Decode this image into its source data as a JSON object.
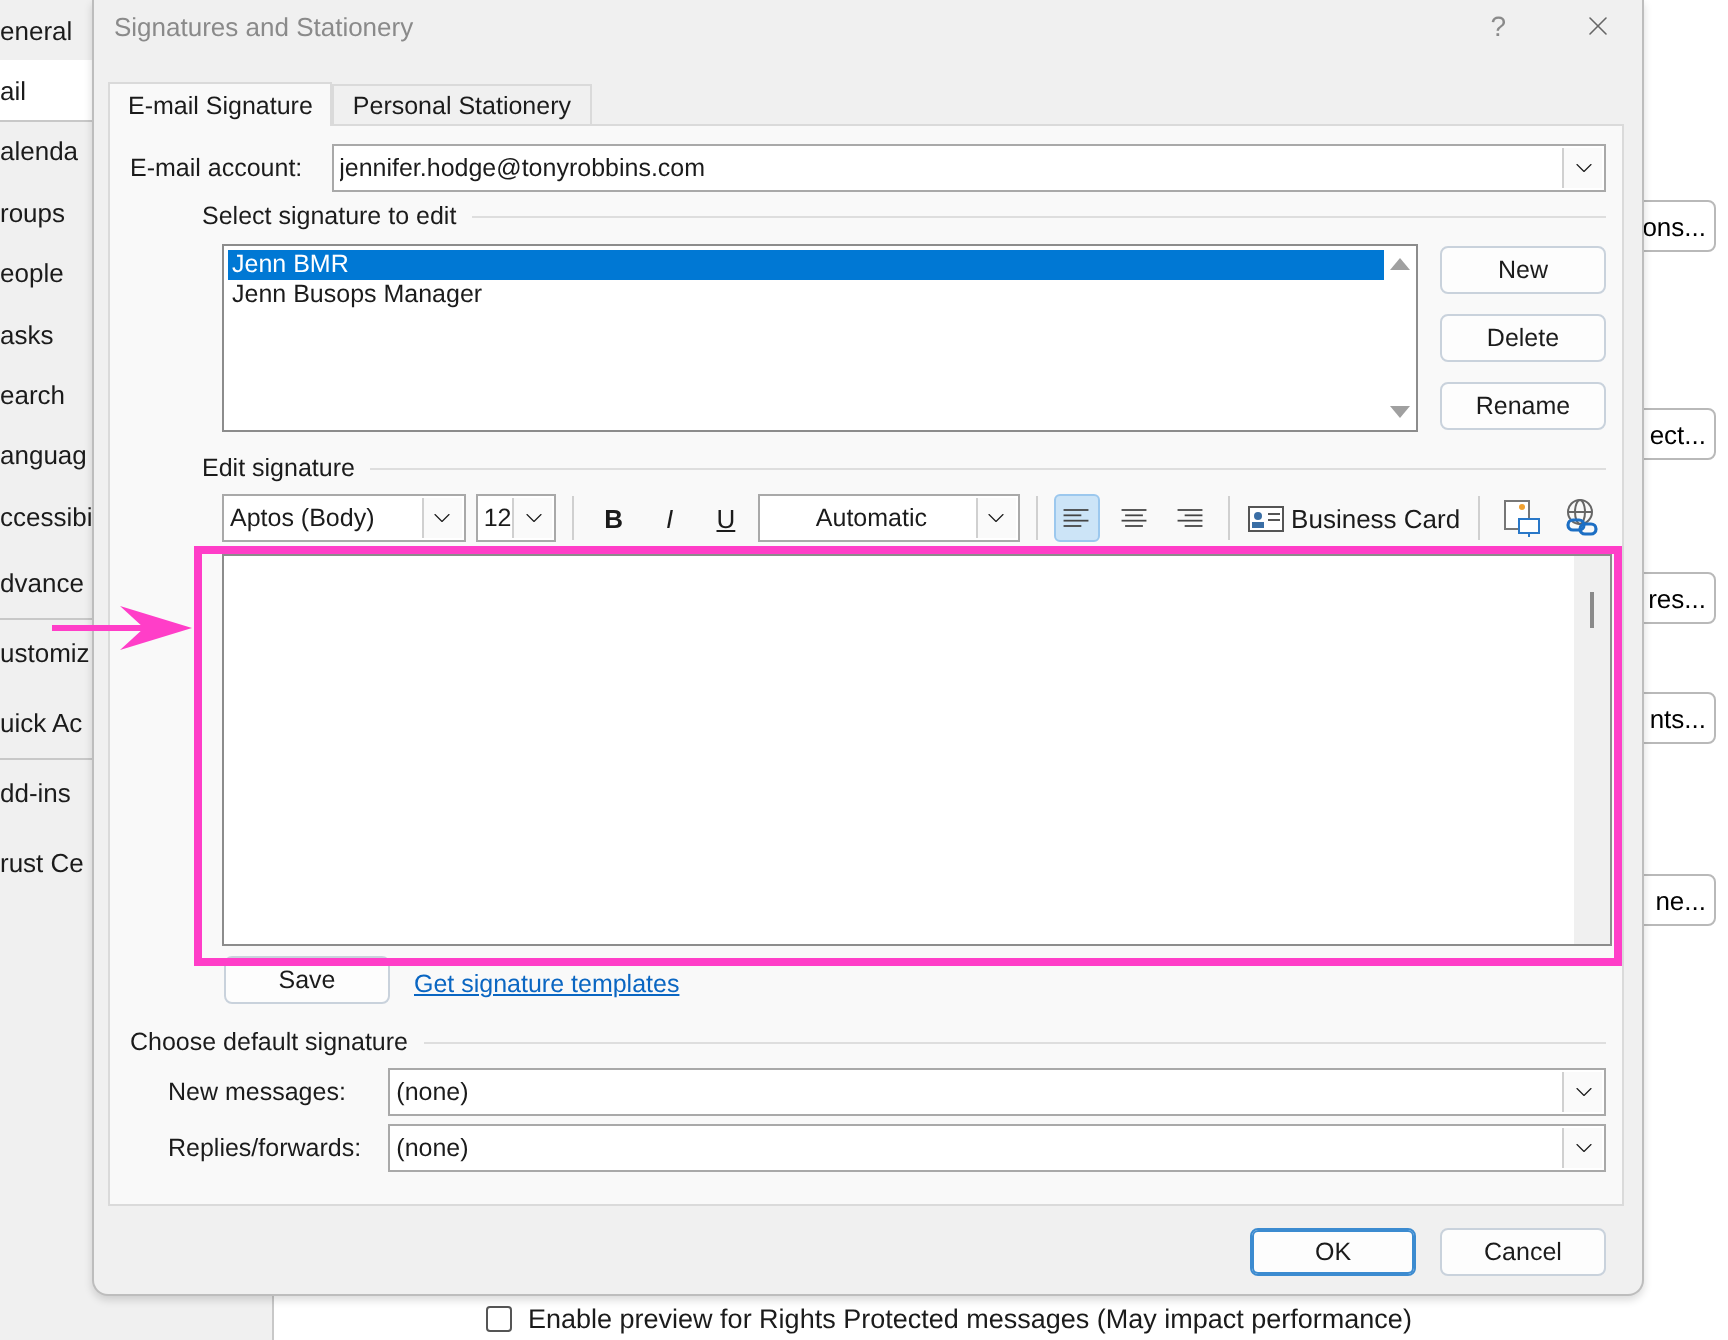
{
  "options_window": {
    "sidebar": [
      {
        "label": "eneral",
        "selected": false,
        "separator_before": false
      },
      {
        "label": "ail",
        "selected": true,
        "separator_before": false
      },
      {
        "label": "alenda",
        "selected": false,
        "separator_before": false
      },
      {
        "label": "roups",
        "selected": false,
        "separator_before": false
      },
      {
        "label": "eople",
        "selected": false,
        "separator_before": false
      },
      {
        "label": "asks",
        "selected": false,
        "separator_before": false
      },
      {
        "label": "earch",
        "selected": false,
        "separator_before": false
      },
      {
        "label": "anguag",
        "selected": false,
        "separator_before": false
      },
      {
        "label": "ccessibi",
        "selected": false,
        "separator_before": false
      },
      {
        "label": "dvance",
        "selected": false,
        "separator_before": false
      },
      {
        "label": "ustomiz",
        "selected": false,
        "separator_before": true
      },
      {
        "label": "uick Ac",
        "selected": false,
        "separator_before": false
      },
      {
        "label": "dd-ins",
        "selected": false,
        "separator_before": true
      },
      {
        "label": "rust Ce",
        "selected": false,
        "separator_before": false
      }
    ],
    "side_buttons": [
      "ons...",
      "ect...",
      "res...",
      "nts...",
      "ne..."
    ],
    "option": {
      "label": "Enable preview for Rights Protected messages (May impact performance)",
      "checked": false
    }
  },
  "dialog": {
    "title": "Signatures and Stationery",
    "help": "?",
    "tabs": [
      {
        "label": "E-mail Signature",
        "selected": true
      },
      {
        "label": "Personal Stationery",
        "selected": false
      }
    ],
    "account": {
      "label": "E-mail account:",
      "value": "jennifer.hodge@tonyrobbins.com"
    },
    "select_label": "Select signature to edit",
    "signatures": [
      {
        "name": "Jenn BMR",
        "selected": true
      },
      {
        "name": "Jenn Busops Manager",
        "selected": false
      }
    ],
    "signature_buttons": [
      "New",
      "Delete",
      "Rename"
    ],
    "edit_label": "Edit signature",
    "toolbar": {
      "font": "Aptos (Body)",
      "size": "12",
      "bold": "B",
      "italic": "I",
      "underline": "U",
      "font_color_label": "Automatic",
      "align": [
        {
          "kind": "left",
          "selected": true
        },
        {
          "kind": "center",
          "selected": false
        },
        {
          "kind": "right",
          "selected": false
        }
      ],
      "business_card": "Business Card"
    },
    "save": "Save",
    "templates_link": "Get signature templates",
    "default_label": "Choose default signature",
    "defaults": [
      {
        "label": "New messages:",
        "value": "(none)"
      },
      {
        "label": "Replies/forwards:",
        "value": "(none)"
      }
    ],
    "footer": [
      {
        "label": "OK",
        "default": true
      },
      {
        "label": "Cancel",
        "default": false
      }
    ]
  }
}
